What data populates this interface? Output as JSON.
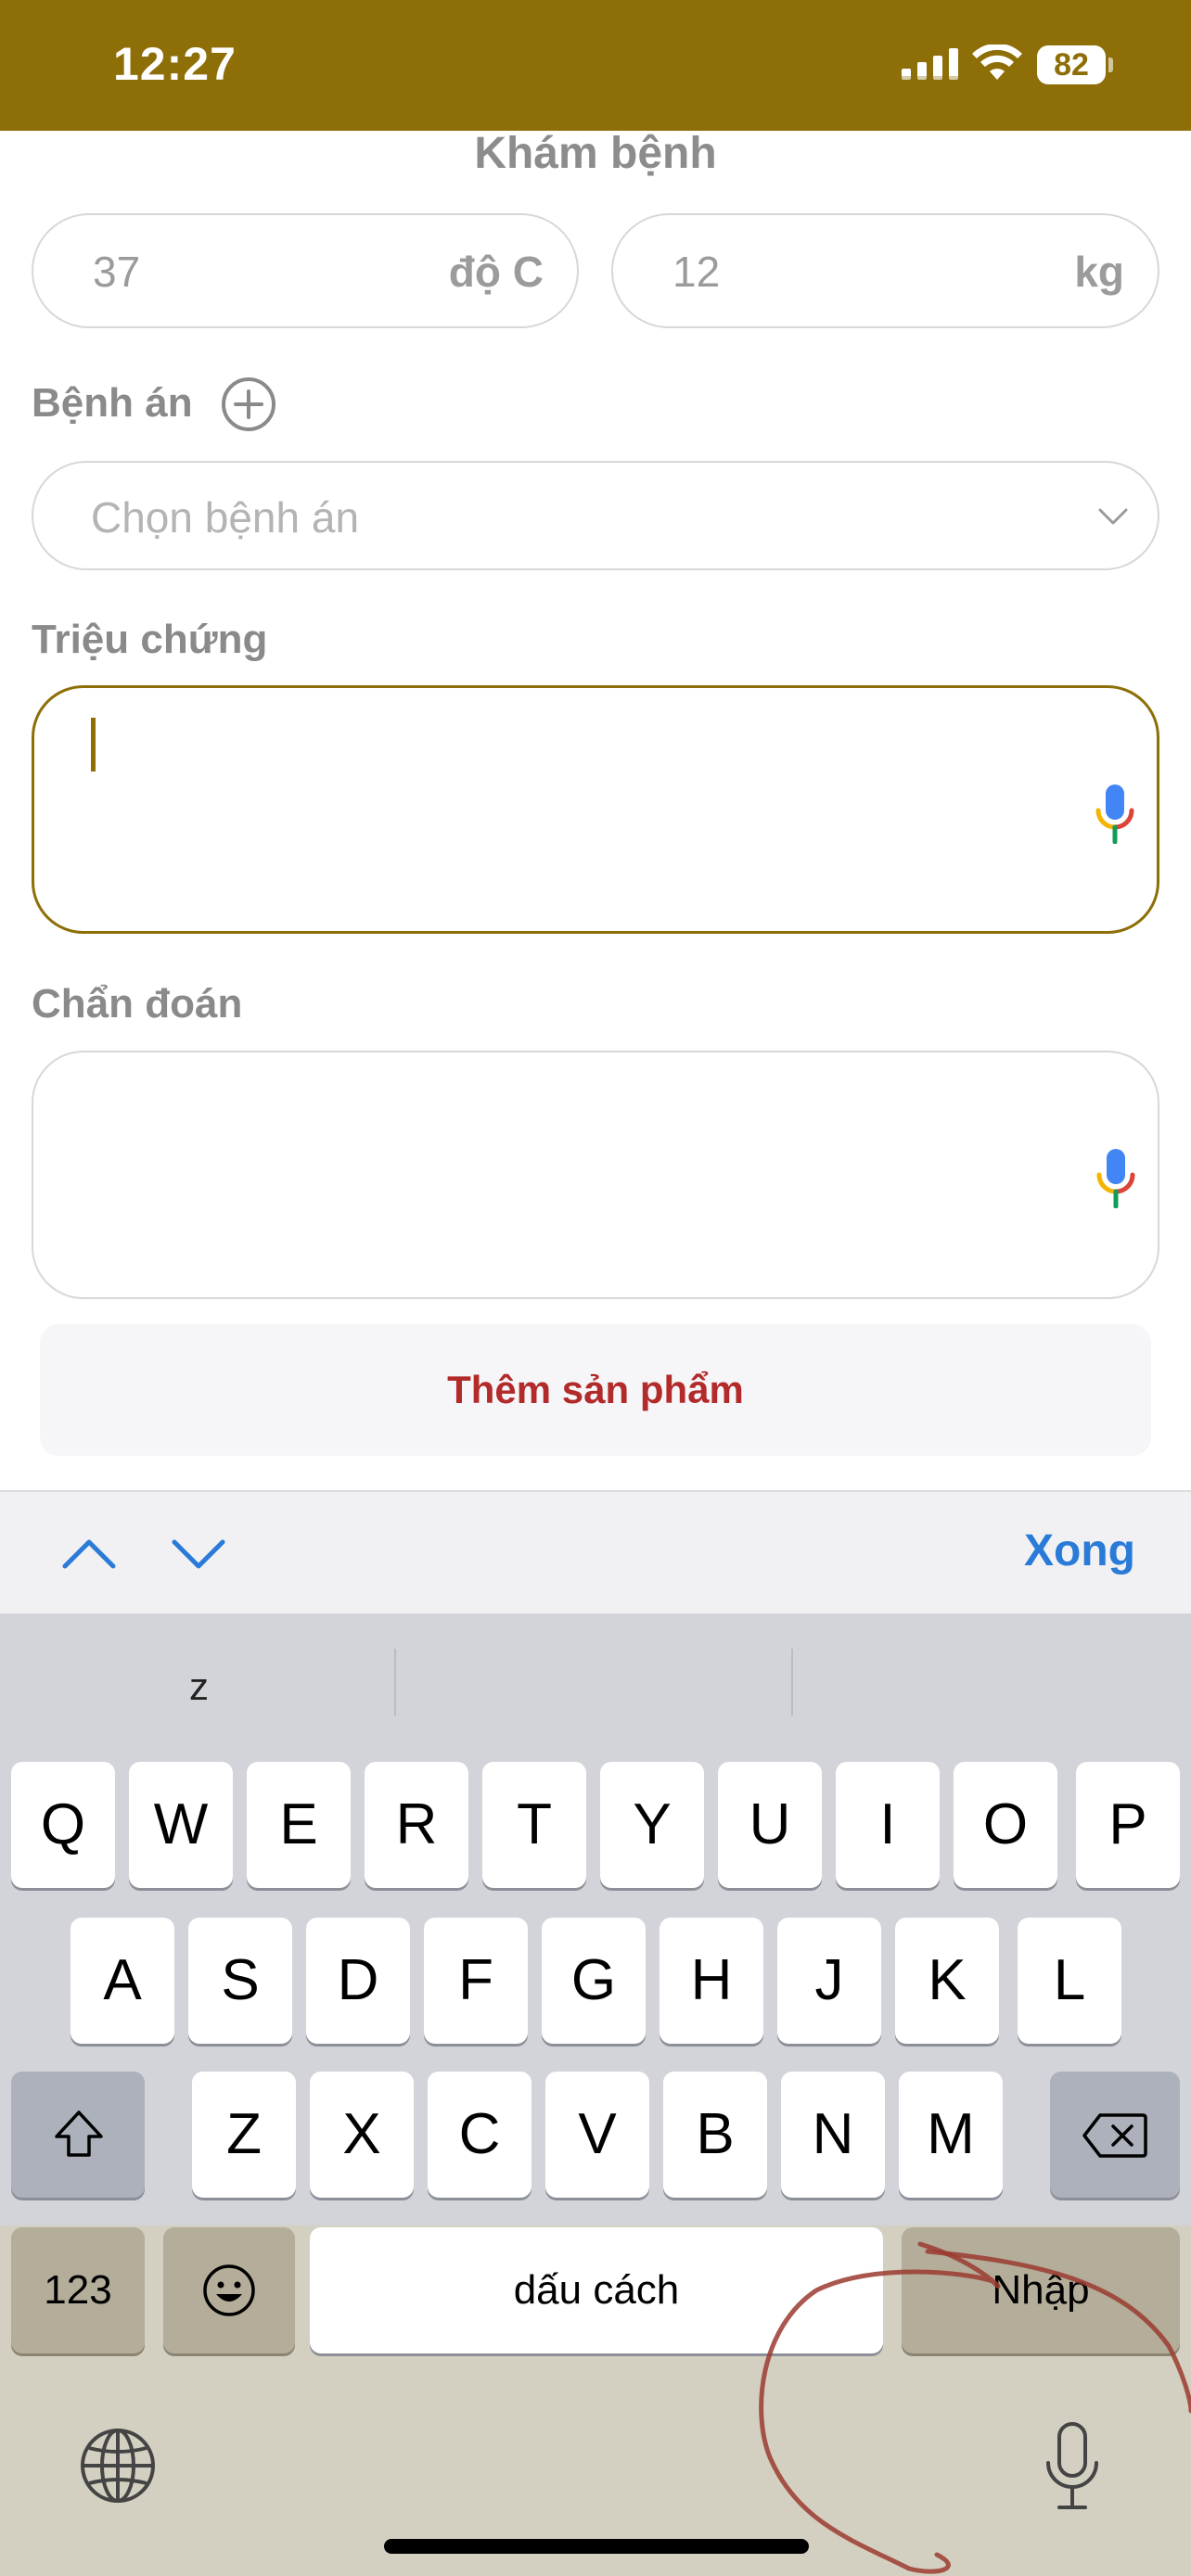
{
  "status_bar": {
    "time": "12:27",
    "battery": "82",
    "background": "#8d6e07"
  },
  "form": {
    "title": "Khám bệnh",
    "temperature": {
      "value": "37",
      "unit": "độ C"
    },
    "weight": {
      "value": "12",
      "unit": "kg"
    },
    "medical_record": {
      "label": "Bệnh án",
      "placeholder": "Chọn bệnh án"
    },
    "symptoms": {
      "label": "Triệu chứng",
      "value": ""
    },
    "diagnosis": {
      "label": "Chẩn đoán",
      "value": ""
    },
    "add_product_label": "Thêm sản phẩm",
    "accent_color": "#8d6e07",
    "add_product_color": "#b22a2a"
  },
  "keyboard_toolbar": {
    "previous_icon": "chevron-up-icon",
    "next_icon": "chevron-down-icon",
    "done_label": "Xong"
  },
  "keyboard": {
    "suggestions": [
      "z",
      "",
      ""
    ],
    "row1": [
      "Q",
      "W",
      "E",
      "R",
      "T",
      "Y",
      "U",
      "I",
      "O",
      "P"
    ],
    "row2": [
      "A",
      "S",
      "D",
      "F",
      "G",
      "H",
      "J",
      "K",
      "L"
    ],
    "row3": [
      "Z",
      "X",
      "C",
      "V",
      "B",
      "N",
      "M"
    ],
    "numbers_label": "123",
    "space_label": "dấu cách",
    "return_label": "Nhập",
    "icons": [
      "shift-icon",
      "backspace-icon",
      "emoji-icon",
      "globe-icon",
      "microphone-icon"
    ]
  }
}
